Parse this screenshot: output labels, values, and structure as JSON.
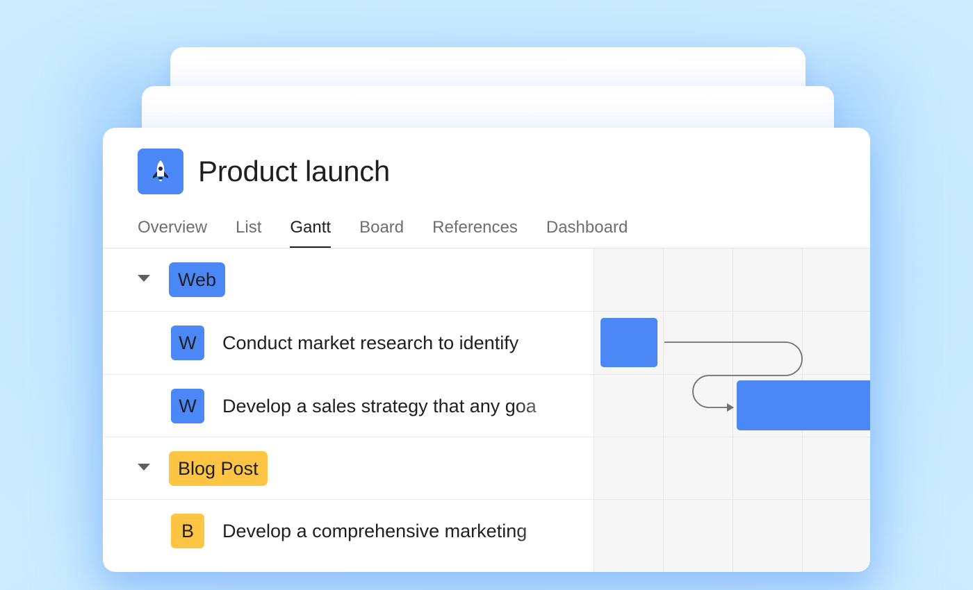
{
  "project": {
    "title": "Product launch",
    "icon": "rocket-icon",
    "icon_color": "#4b87f5"
  },
  "tabs": [
    {
      "label": "Overview",
      "active": false
    },
    {
      "label": "List",
      "active": false
    },
    {
      "label": "Gantt",
      "active": true
    },
    {
      "label": "Board",
      "active": false
    },
    {
      "label": "References",
      "active": false
    },
    {
      "label": "Dashboard",
      "active": false
    }
  ],
  "sections": [
    {
      "name": "Web",
      "color": "#4b87f5",
      "tasks": [
        {
          "avatar": "W",
          "name": "Conduct market research to identify"
        },
        {
          "avatar": "W",
          "name": "Develop a sales strategy that any goa"
        }
      ]
    },
    {
      "name": "Blog Post",
      "color": "#fdc543",
      "tasks": [
        {
          "avatar": "B",
          "name": "Develop a comprehensive marketing"
        }
      ]
    }
  ],
  "colors": {
    "bar": "#4b87f5",
    "web": "#4b87f5",
    "blog": "#fdc543"
  }
}
